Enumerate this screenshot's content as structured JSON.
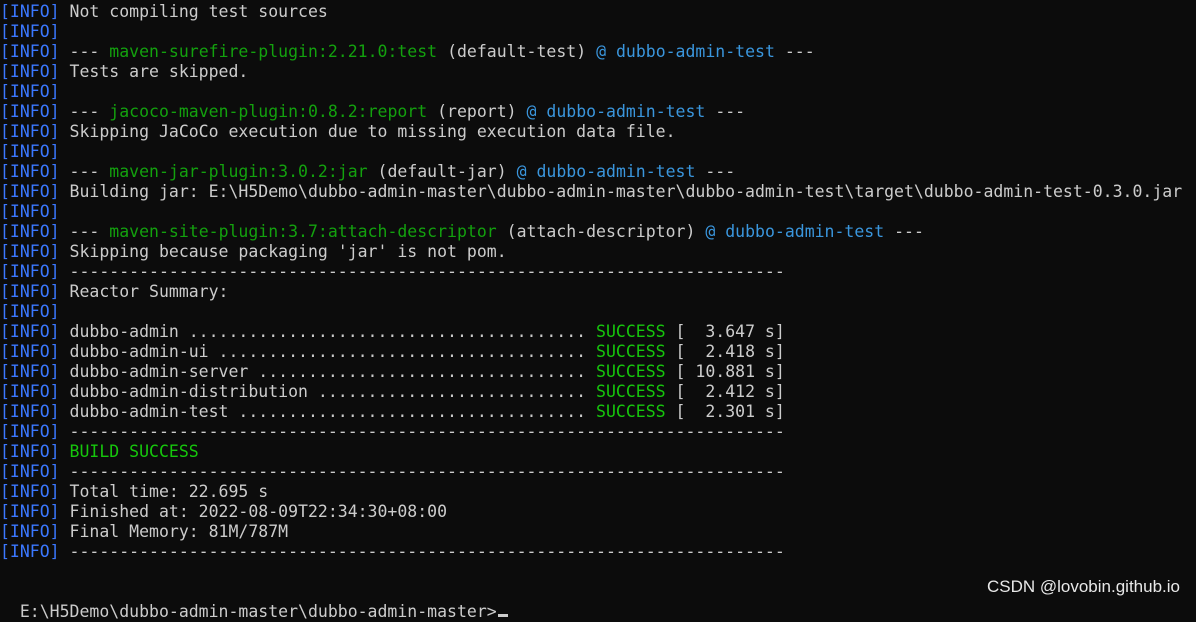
{
  "tag": "[INFO]",
  "colors": {
    "background": "#0c0c0c",
    "text": "#cccccc",
    "info_tag": "#3b78ff",
    "plugin": "#13a10e",
    "project": "#3a96dd",
    "success": "#16c60c"
  },
  "lines": [
    {
      "kind": "text",
      "text": "Not compiling test sources"
    },
    {
      "kind": "blank"
    },
    {
      "kind": "plugin",
      "dashes": "---",
      "plugin": "maven-surefire-plugin:2.21.0:test",
      "goal": "(default-test)",
      "at": "@",
      "project": "dubbo-admin-test",
      "end": "---"
    },
    {
      "kind": "text",
      "text": "Tests are skipped."
    },
    {
      "kind": "blank"
    },
    {
      "kind": "plugin",
      "dashes": "---",
      "plugin": "jacoco-maven-plugin:0.8.2:report",
      "goal": "(report)",
      "at": "@",
      "project": "dubbo-admin-test",
      "end": "---"
    },
    {
      "kind": "text",
      "text": "Skipping JaCoCo execution due to missing execution data file."
    },
    {
      "kind": "blank"
    },
    {
      "kind": "plugin",
      "dashes": "---",
      "plugin": "maven-jar-plugin:3.0.2:jar",
      "goal": "(default-jar)",
      "at": "@",
      "project": "dubbo-admin-test",
      "end": "---"
    },
    {
      "kind": "text",
      "text": "Building jar: E:\\H5Demo\\dubbo-admin-master\\dubbo-admin-master\\dubbo-admin-test\\target\\dubbo-admin-test-0.3.0.jar"
    },
    {
      "kind": "blank"
    },
    {
      "kind": "plugin",
      "dashes": "---",
      "plugin": "maven-site-plugin:3.7:attach-descriptor",
      "goal": "(attach-descriptor)",
      "at": "@",
      "project": "dubbo-admin-test",
      "end": "---"
    },
    {
      "kind": "text",
      "text": "Skipping because packaging 'jar' is not pom."
    },
    {
      "kind": "text",
      "text": "------------------------------------------------------------------------"
    },
    {
      "kind": "text",
      "text": "Reactor Summary:"
    },
    {
      "kind": "blank"
    },
    {
      "kind": "summary",
      "module": "dubbo-admin ........................................",
      "status": "SUCCESS",
      "time": "[  3.647 s]"
    },
    {
      "kind": "summary",
      "module": "dubbo-admin-ui .....................................",
      "status": "SUCCESS",
      "time": "[  2.418 s]"
    },
    {
      "kind": "summary",
      "module": "dubbo-admin-server .................................",
      "status": "SUCCESS",
      "time": "[ 10.881 s]"
    },
    {
      "kind": "summary",
      "module": "dubbo-admin-distribution ...........................",
      "status": "SUCCESS",
      "time": "[  2.412 s]"
    },
    {
      "kind": "summary",
      "module": "dubbo-admin-test ...................................",
      "status": "SUCCESS",
      "time": "[  2.301 s]"
    },
    {
      "kind": "text",
      "text": "------------------------------------------------------------------------"
    },
    {
      "kind": "success",
      "text": "BUILD SUCCESS"
    },
    {
      "kind": "text",
      "text": "------------------------------------------------------------------------"
    },
    {
      "kind": "text",
      "text": "Total time: 22.695 s"
    },
    {
      "kind": "text",
      "text": "Finished at: 2022-08-09T22:34:30+08:00"
    },
    {
      "kind": "text",
      "text": "Final Memory: 81M/787M"
    },
    {
      "kind": "text",
      "text": "------------------------------------------------------------------------"
    }
  ],
  "prompt": "E:\\H5Demo\\dubbo-admin-master\\dubbo-admin-master>",
  "watermark": "CSDN @lovobin.github.io"
}
